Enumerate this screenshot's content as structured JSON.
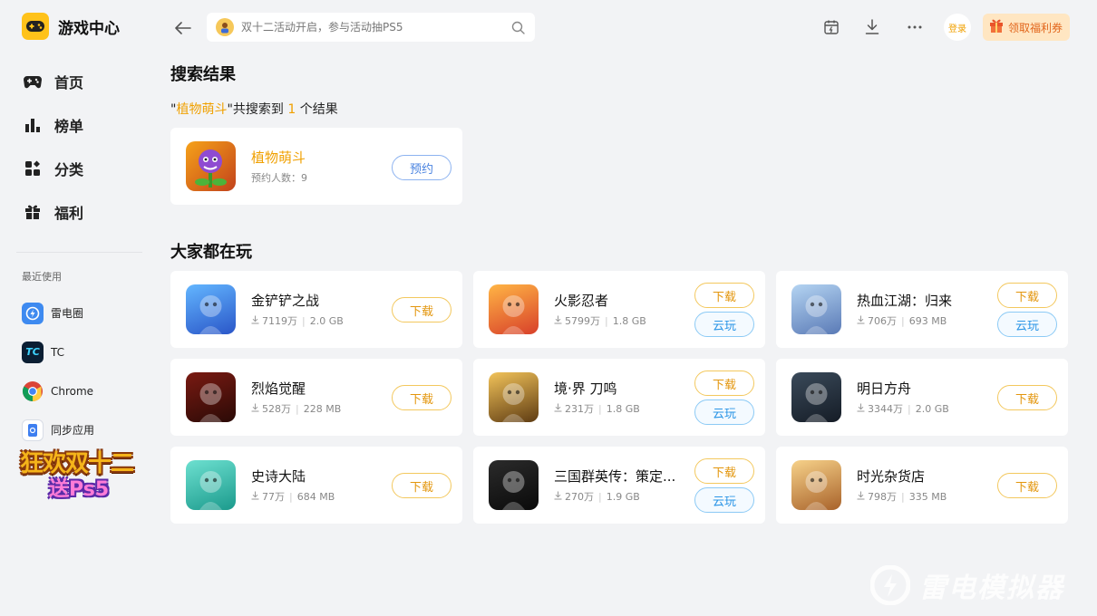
{
  "app": {
    "title": "游戏中心"
  },
  "sidebar": {
    "nav": [
      {
        "label": "首页",
        "icon": "gamepad-icon"
      },
      {
        "label": "榜单",
        "icon": "ranking-icon"
      },
      {
        "label": "分类",
        "icon": "category-icon"
      },
      {
        "label": "福利",
        "icon": "gift-icon"
      }
    ],
    "recent_title": "最近使用",
    "recent": [
      {
        "label": "雷电圈",
        "icon": "leidian-circle-icon"
      },
      {
        "label": "TC",
        "icon": "tc-icon"
      },
      {
        "label": "Chrome",
        "icon": "chrome-icon"
      },
      {
        "label": "同步应用",
        "icon": "sync-app-icon"
      }
    ],
    "promo": {
      "line1": "狂欢双十二",
      "line2": "送Ps5"
    }
  },
  "header": {
    "search_placeholder": "双十二活动开启，参与活动抽PS5",
    "login_label": "登录",
    "coupon_label": "领取福利券"
  },
  "search_results": {
    "title": "搜索结果",
    "summary": {
      "open_quote": "\"",
      "query": "植物萌斗",
      "mid": "\"共搜索到",
      "count": "1",
      "end": "个结果"
    },
    "items": [
      {
        "name": "植物萌斗",
        "meta": "预约人数：9",
        "button": "预约"
      }
    ]
  },
  "popular": {
    "title": "大家都在玩",
    "games": [
      {
        "name": "金铲铲之战",
        "downloads": "7119万",
        "size": "2.0 GB",
        "download_label": "下载"
      },
      {
        "name": "火影忍者",
        "downloads": "5799万",
        "size": "1.8 GB",
        "download_label": "下载",
        "cloud_label": "云玩"
      },
      {
        "name": "热血江湖：归来",
        "downloads": "706万",
        "size": "693 MB",
        "download_label": "下载",
        "cloud_label": "云玩"
      },
      {
        "name": "烈焰觉醒",
        "downloads": "528万",
        "size": "228 MB",
        "download_label": "下载"
      },
      {
        "name": "境·界 刀鸣",
        "downloads": "231万",
        "size": "1.8 GB",
        "download_label": "下载",
        "cloud_label": "云玩"
      },
      {
        "name": "明日方舟",
        "downloads": "3344万",
        "size": "2.0 GB",
        "download_label": "下载"
      },
      {
        "name": "史诗大陆",
        "downloads": "77万",
        "size": "684 MB",
        "download_label": "下载"
      },
      {
        "name": "三国群英传：策定...",
        "downloads": "270万",
        "size": "1.9 GB",
        "download_label": "下载",
        "cloud_label": "云玩"
      },
      {
        "name": "时光杂货店",
        "downloads": "798万",
        "size": "335 MB",
        "download_label": "下载"
      }
    ]
  },
  "watermark": {
    "text": "雷电模拟器"
  },
  "colors": {
    "accent": "#f0a000",
    "brand_yellow": "#ffc21a",
    "cloud_blue": "#2b95e6",
    "background": "#f2f3f5"
  }
}
